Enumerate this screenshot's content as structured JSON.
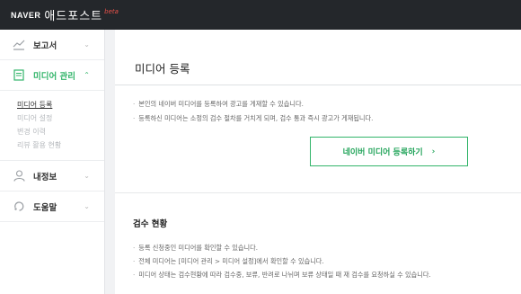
{
  "header": {
    "brand": "NAVER",
    "title": "애드포스트",
    "beta": "beta"
  },
  "sidebar": {
    "items": [
      {
        "label": "보고서",
        "icon": "chart-line-icon",
        "expanded": false
      },
      {
        "label": "미디어 관리",
        "icon": "document-icon",
        "expanded": true,
        "children": [
          "미디어 등록",
          "미디어 설정",
          "변경 이력",
          "리뷰 활용 현황"
        ]
      },
      {
        "label": "내정보",
        "icon": "person-icon",
        "expanded": false
      },
      {
        "label": "도움말",
        "icon": "help-icon",
        "expanded": false
      }
    ]
  },
  "main": {
    "title": "미디어 등록",
    "notes": [
      "본인의 네이버 미디어를 등록하여 광고를 게재할 수 있습니다.",
      "등록하신 미디어는 소정의 검수 절차를 거치게 되며, 검수 통과 즉시 광고가 게재됩니다."
    ],
    "register_button": "네이버 미디어 등록하기",
    "review_section": {
      "title": "검수 현황",
      "notes": [
        "등록 신청중인 미디어를 확인할 수 있습니다.",
        "전체 미디어는 [미디어 관리 > 미디어 설정]에서 확인할 수 있습니다.",
        "미디어 상태는 검수현황에 따라 검수중, 보류, 반려로 나뉘며 보류 상태일 때 재 검수를 요청하실 수 있습니다."
      ]
    }
  },
  "colors": {
    "topbar": "#24272b",
    "accent": "#33b56a",
    "beta": "#e8524a"
  }
}
